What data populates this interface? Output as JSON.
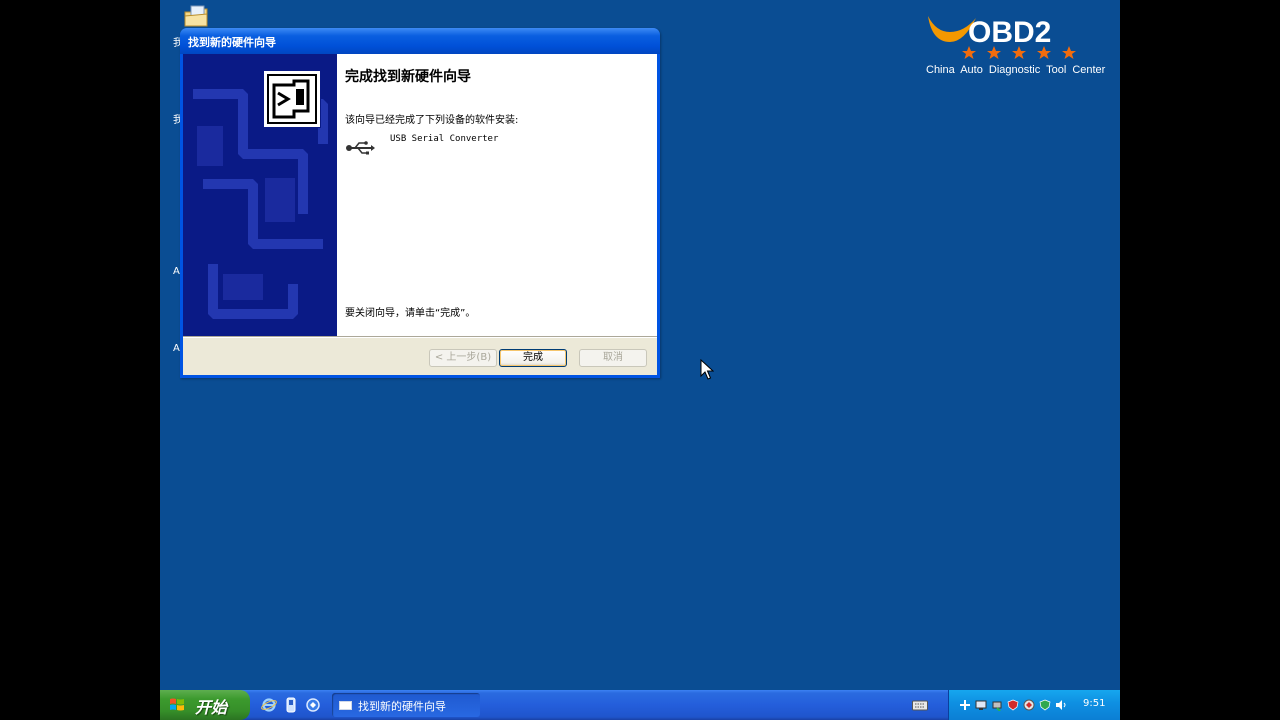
{
  "desktop": {
    "left_glyphs": [
      "我",
      "我",
      "A",
      "A"
    ]
  },
  "logo": {
    "text": "OBD2",
    "tagline": "China  Auto  Diagnostic  Tool  Center"
  },
  "dialog": {
    "title": "找到新的硬件向导",
    "heading": "完成找到新硬件向导",
    "description": "该向导已经完成了下列设备的软件安装:",
    "device": "USB Serial Converter",
    "close_hint": "要关闭向导，请单击“完成”。",
    "buttons": {
      "back": "< 上一步(B)",
      "finish": "完成",
      "cancel": "取消"
    }
  },
  "taskbar": {
    "start_label": "开始",
    "task_label": "找到新的硬件向导",
    "clock": "9:51"
  },
  "colors": {
    "desktop": "#0a4d93",
    "sidebar": "#0a1a86",
    "logo_orange": "#f39800",
    "tray": "#0f91e3"
  }
}
